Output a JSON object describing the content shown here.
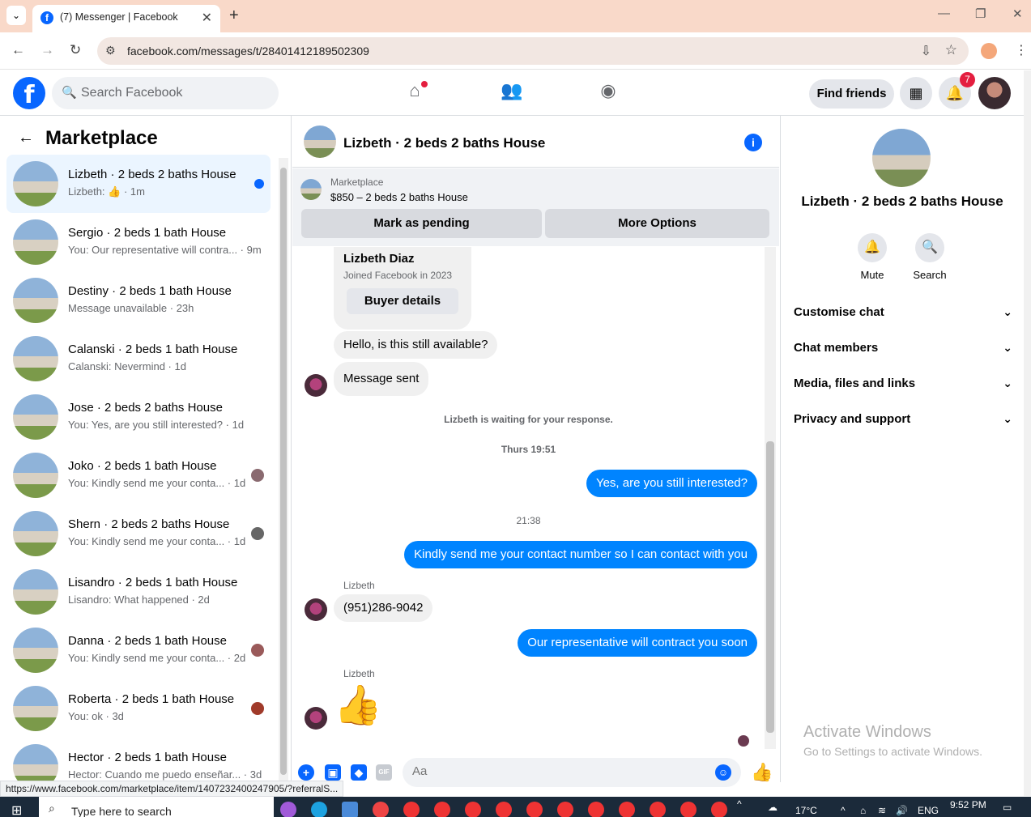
{
  "browser": {
    "tab_title": "(7) Messenger | Facebook",
    "url": "facebook.com/messages/t/28401412189502309",
    "status_url": "https://www.facebook.com/marketplace/item/1407232400247905/?referralS..."
  },
  "fb": {
    "search_placeholder": "Search Facebook",
    "find_friends": "Find friends",
    "notif_count": "7"
  },
  "sidebar": {
    "title": "Marketplace",
    "conversations": [
      {
        "title": "Lizbeth · 2 beds 2 baths House",
        "snippet": "Lizbeth: 👍 · 1m",
        "active": true
      },
      {
        "title": "Sergio · 2 beds 1 bath House",
        "snippet": "You: Our representative will contra... · 9m"
      },
      {
        "title": "Destiny · 2 beds 1 bath House",
        "snippet": "Message unavailable · 23h"
      },
      {
        "title": "Calanski · 2 beds 1 bath House",
        "snippet": "Calanski: Nevermind · 1d"
      },
      {
        "title": "Jose · 2 beds 2 baths House",
        "snippet": "You: Yes, are you still interested? · 1d"
      },
      {
        "title": "Joko · 2 beds 1 bath House",
        "snippet": "You: Kindly send me your conta... · 1d"
      },
      {
        "title": "Shern · 2 beds 2 baths House",
        "snippet": "You: Kindly send me your conta... · 1d"
      },
      {
        "title": "Lisandro · 2 beds 1 bath House",
        "snippet": "Lisandro: What happened · 2d"
      },
      {
        "title": "Danna · 2 beds 1 bath House",
        "snippet": "You: Kindly send me your conta... · 2d"
      },
      {
        "title": "Roberta · 2 beds 1 bath House",
        "snippet": "You: ok · 3d"
      },
      {
        "title": "Hector · 2 beds 1 bath House",
        "snippet": "Hector: Cuando me puedo enseñar... · 3d"
      }
    ]
  },
  "chat": {
    "header_name": "Lizbeth · 2 beds 2 baths House",
    "listing_category": "Marketplace",
    "listing_price": "$850 – 2 beds 2 baths House",
    "mark_pending": "Mark as pending",
    "more_options": "More Options",
    "card_name": "Lizbeth Diaz",
    "card_joined": "Joined Facebook in 2023",
    "buyer_details": "Buyer details",
    "msg1": "Hello, is this still available?",
    "msg2": "Message sent",
    "waiting_note": "Lizbeth is waiting for your response.",
    "time1": "Thurs 19:51",
    "out1": "Yes, are you still interested?",
    "time2": "21:38",
    "out2": "Kindly send me your contact number so I can contact with you",
    "sender_label": "Lizbeth",
    "msg3": "(951)286-9042",
    "out3": "Our representative will contract you soon",
    "composer_placeholder": "Aa"
  },
  "panel": {
    "name": "Lizbeth · 2 beds 2 baths House",
    "mute": "Mute",
    "search": "Search",
    "rows": [
      "Customise chat",
      "Chat members",
      "Media, files and links",
      "Privacy and support"
    ]
  },
  "watermark": {
    "line1": "Activate Windows",
    "line2": "Go to Settings to activate Windows."
  },
  "taskbar": {
    "search_placeholder": "Type here to search",
    "temp": "17°C",
    "lang": "ENG",
    "time": "9:52 PM"
  }
}
